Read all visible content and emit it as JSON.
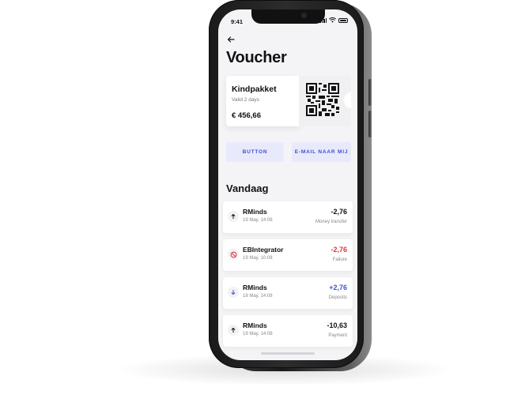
{
  "status_bar": {
    "time": "9:41"
  },
  "page": {
    "title": "Voucher"
  },
  "voucher": {
    "name": "Kindpakket",
    "validity": "Valid 2 days",
    "amount": "€ 456,66"
  },
  "actions": {
    "button1_label": "BUTTON",
    "button2_label": "E-MAIL NAAR MIJ"
  },
  "section": {
    "title": "Vandaag"
  },
  "transactions": [
    {
      "name": "RMinds",
      "date": "19 May, 14:08",
      "amount": "-2,76",
      "type": "Money transfer",
      "icon": "arrow-up-icon",
      "amount_color": "#111111"
    },
    {
      "name": "EBIntegrator",
      "date": "19 May, 10:08",
      "amount": "-2,76",
      "type": "Failure",
      "icon": "blocked-icon",
      "amount_color": "#e0333a"
    },
    {
      "name": "RMinds",
      "date": "18 May, 14:08",
      "amount": "+2,76",
      "type": "Deposits",
      "icon": "arrow-down-icon",
      "amount_color": "#3b55d9"
    },
    {
      "name": "RMinds",
      "date": "19 May, 14:08",
      "amount": "-10,63",
      "type": "Payment",
      "icon": "arrow-up-icon",
      "amount_color": "#111111"
    }
  ],
  "colors": {
    "accent": "#3b4fd0",
    "button_bg": "#e8eafc",
    "failure": "#e0333a",
    "deposit": "#3b55d9"
  }
}
